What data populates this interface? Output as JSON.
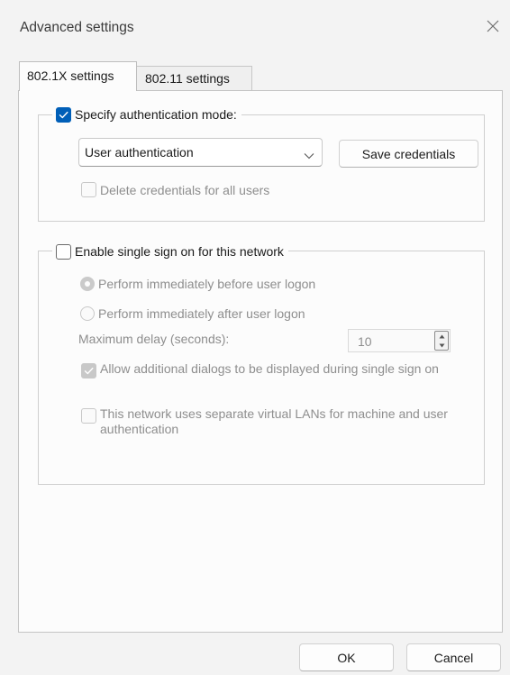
{
  "window": {
    "title": "Advanced settings",
    "close_icon": "close-icon"
  },
  "tabs": [
    {
      "label": "802.1X settings",
      "active": true
    },
    {
      "label": "802.11 settings",
      "active": false
    }
  ],
  "auth_group": {
    "specify_mode_label": "Specify authentication mode:",
    "specify_mode_checked": true,
    "mode_selected": "User authentication",
    "save_credentials_label": "Save credentials",
    "delete_credentials_label": "Delete credentials for all users",
    "delete_credentials_checked": false
  },
  "sso_group": {
    "enable_label": "Enable single sign on for this network",
    "enable_checked": false,
    "before_logon_label": "Perform immediately before user logon",
    "after_logon_label": "Perform immediately after user logon",
    "max_delay_label": "Maximum delay (seconds):",
    "max_delay_value": "10",
    "allow_dialogs_label": "Allow additional dialogs to be displayed during single sign on",
    "allow_dialogs_checked": true,
    "vlan_label": "This network uses separate virtual LANs for machine and user authentication",
    "vlan_checked": false
  },
  "footer": {
    "ok_label": "OK",
    "cancel_label": "Cancel"
  },
  "colors": {
    "accent": "#005fb8",
    "background": "#f3f3f3",
    "panel": "#fcfcfc",
    "disabled_text": "#8e8e8e"
  }
}
